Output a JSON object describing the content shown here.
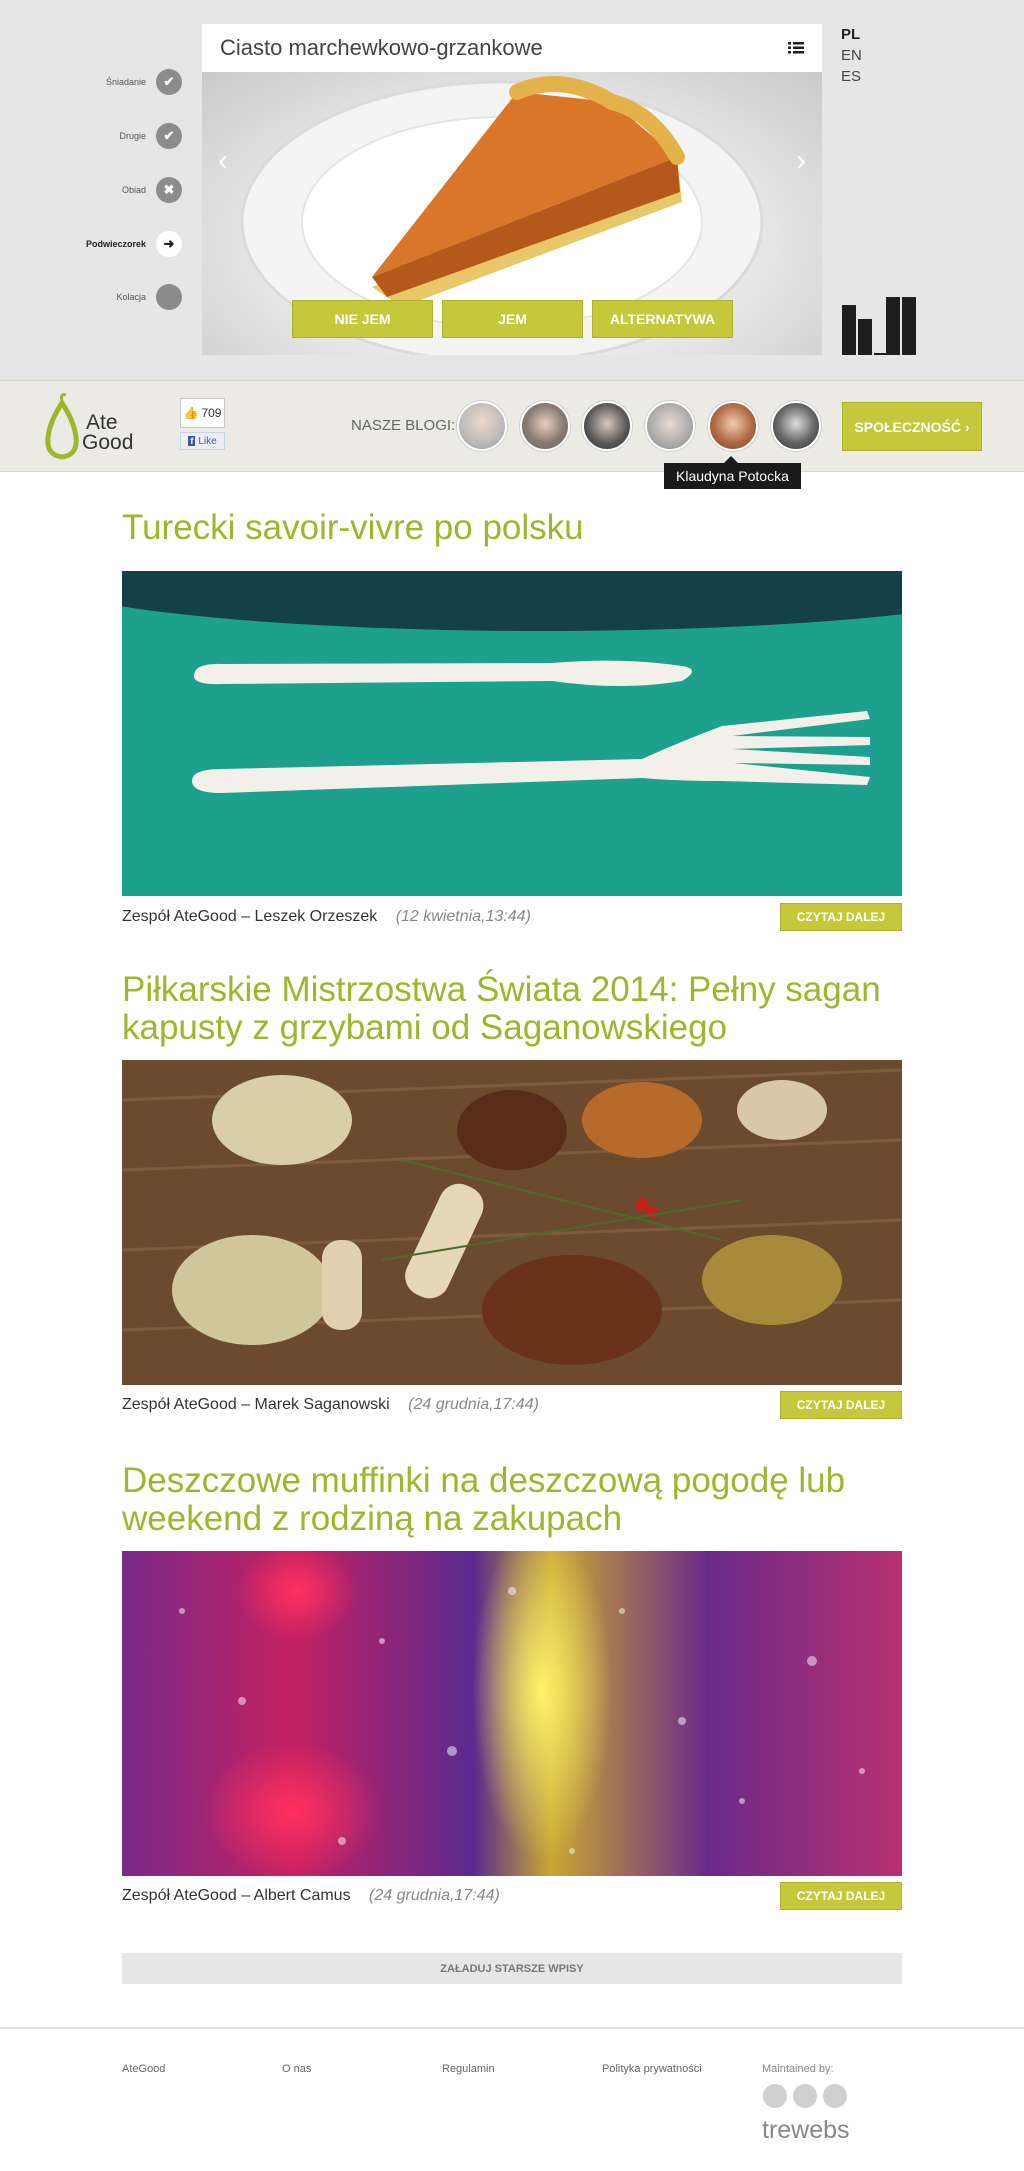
{
  "hero": {
    "meals": [
      {
        "label": "Śniadanie",
        "state": "done",
        "icon": "check-icon",
        "glyph": "✔"
      },
      {
        "label": "Drugie",
        "state": "done",
        "icon": "check-icon",
        "glyph": "✔"
      },
      {
        "label": "Obiad",
        "state": "skipped",
        "icon": "x-icon",
        "glyph": "✖"
      },
      {
        "label": "Podwieczorek",
        "state": "current",
        "icon": "arrow-right-icon",
        "glyph": "➜"
      },
      {
        "label": "Kolacja",
        "state": "pending",
        "icon": "",
        "glyph": ""
      }
    ],
    "slider_title": "Ciasto marchewkowo-grzankowe",
    "buttons": {
      "nie_jem": "NIE JEM",
      "jem": "JEM",
      "alternatywa": "ALTERNATYWA"
    },
    "languages": [
      "PL",
      "EN",
      "ES"
    ],
    "active_language": "PL"
  },
  "blogbar": {
    "like_count": "709",
    "like_label": "Like",
    "blogs_label": "NASZE BLOGI:",
    "community_label": "SPOŁECZNOŚĆ ›",
    "tooltip": "Klaudyna Potocka"
  },
  "posts": [
    {
      "title": "Turecki savoir-vivre po polsku",
      "author": "Zespół AteGood – Leszek Orzeszek",
      "date": "(12 kwietnia,13:44)",
      "read_more": "CZYTAJ DALEJ"
    },
    {
      "title": "Piłkarskie Mistrzostwa Świata 2014: Pełny sagan kapusty z grzybami od Saganowskiego",
      "author": "Zespół AteGood – Marek Saganowski",
      "date": "(24 grudnia,17:44)",
      "read_more": "CZYTAJ DALEJ"
    },
    {
      "title": "Deszczowe muffinki na deszczową pogodę lub weekend z rodziną na zakupach",
      "author": "Zespół AteGood – Albert Camus",
      "date": "(24 grudnia,17:44)",
      "read_more": "CZYTAJ DALEJ"
    }
  ],
  "load_more": "ZAŁADUJ STARSZE WPISY",
  "footer": {
    "links": [
      "AteGood",
      "O nas",
      "Regulamin",
      "Polityka prywatności"
    ],
    "maintained_by": "Maintained by:",
    "maintainer": "trewebs"
  },
  "colors": {
    "accent": "#c5c83a",
    "title_green": "#9cb72c",
    "hero_bg": "#e6e6e6",
    "blogbar_bg": "#ebeae5"
  }
}
